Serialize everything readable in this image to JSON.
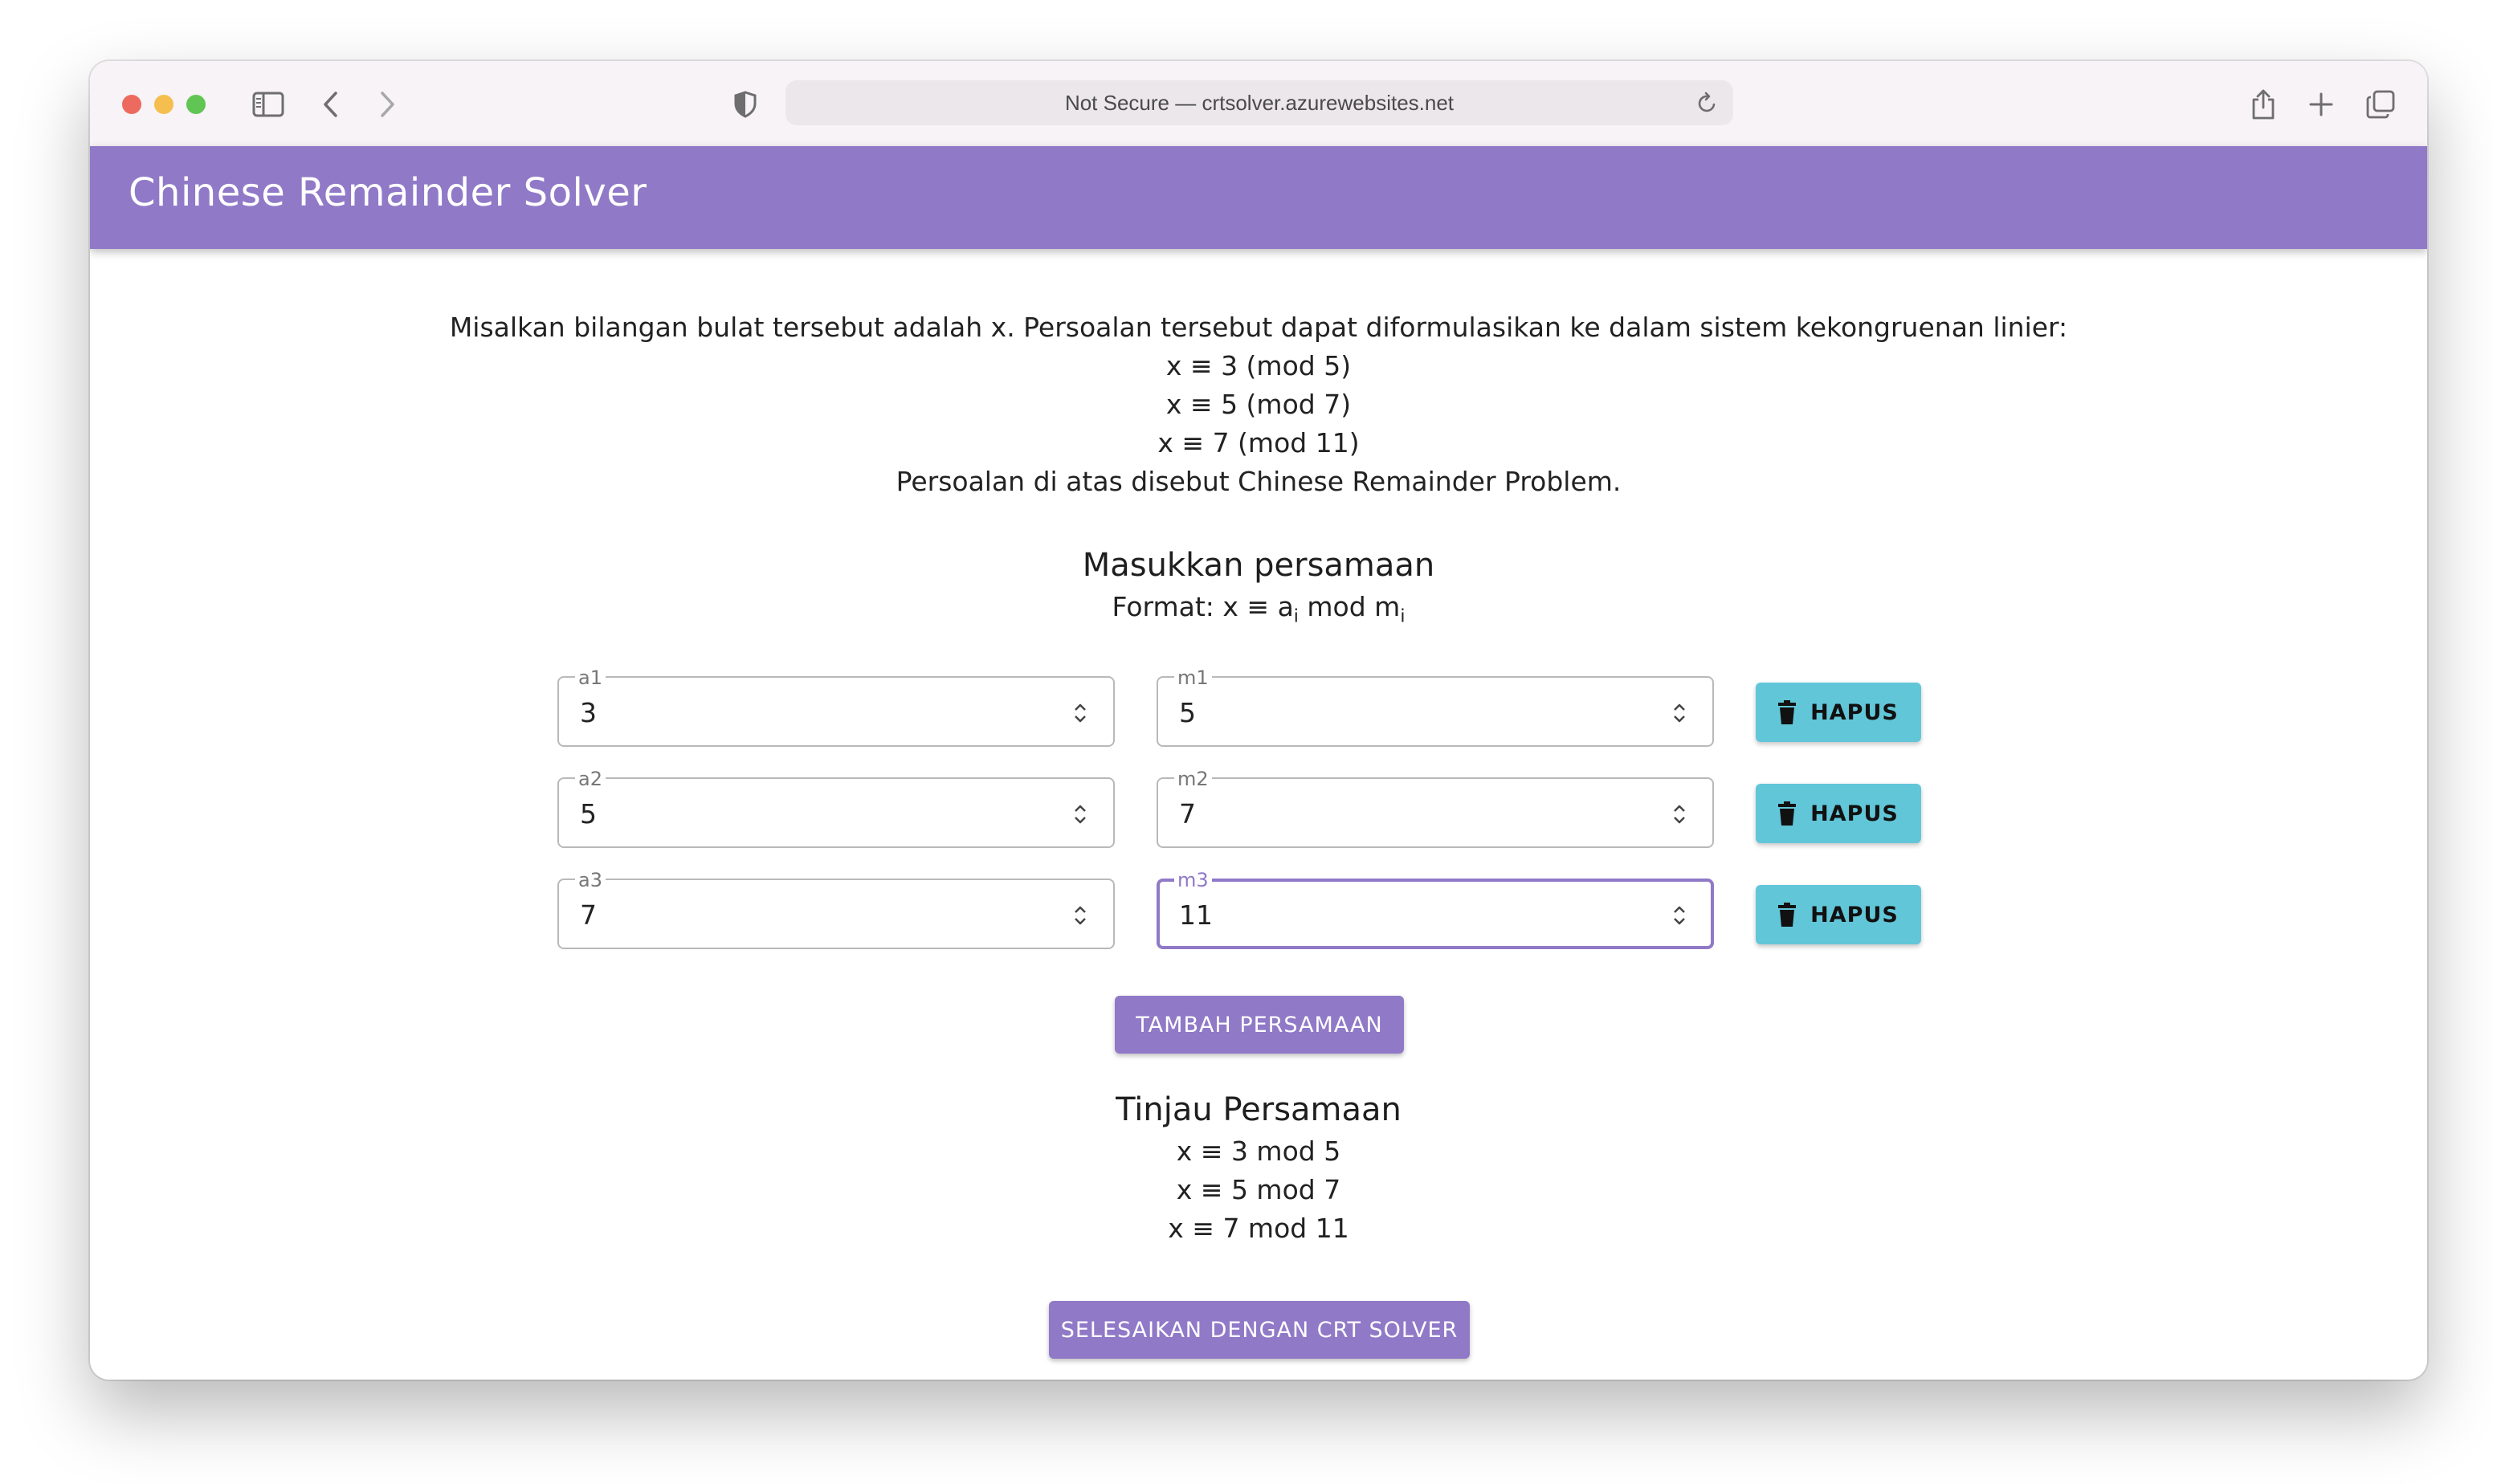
{
  "browser": {
    "url_text": "Not Secure — crtsolver.azurewebsites.net"
  },
  "app": {
    "title": "Chinese Remainder Solver"
  },
  "intro": {
    "line": "Misalkan bilangan bulat tersebut adalah x. Persoalan tersebut dapat diformulasikan ke dalam sistem kekongruenan linier:",
    "congruences": [
      "x ≡ 3 (mod 5)",
      "x ≡ 5 (mod 7)",
      "x ≡ 7 (mod 11)"
    ],
    "closing": "Persoalan di atas disebut Chinese Remainder Problem."
  },
  "input_section": {
    "heading": "Masukkan persamaan",
    "format_prefix": "Format: x ≡ a",
    "format_sub_i": "i",
    "format_mid": " mod m",
    "format_sub_i2": "i"
  },
  "equations": [
    {
      "a_label": "a1",
      "a_value": "3",
      "m_label": "m1",
      "m_value": "5",
      "delete_label": "HAPUS"
    },
    {
      "a_label": "a2",
      "a_value": "5",
      "m_label": "m2",
      "m_value": "7",
      "delete_label": "HAPUS"
    },
    {
      "a_label": "a3",
      "a_value": "7",
      "m_label": "m3",
      "m_value": "11",
      "delete_label": "HAPUS"
    }
  ],
  "add_button": "TAMBAH PERSAMAAN",
  "review": {
    "heading": "Tinjau Persamaan",
    "lines": [
      "x ≡ 3 mod 5",
      "x ≡ 5 mod 7",
      "x ≡ 7 mod 11"
    ]
  },
  "solve_button": "SELESAIKAN DENGAN CRT SOLVER",
  "colors": {
    "primary": "#9079c7",
    "delete_button": "#62c6d9"
  },
  "icons": [
    "sidebar-icon",
    "back-icon",
    "forward-icon",
    "shield-icon",
    "reload-icon",
    "share-icon",
    "new-tab-icon",
    "tabs-icon",
    "trash-icon"
  ]
}
